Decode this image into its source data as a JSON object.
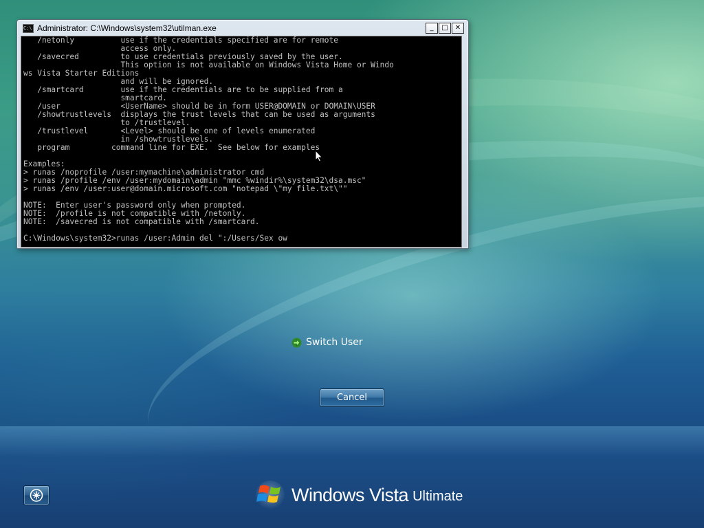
{
  "window": {
    "title": "Administrator: C:\\Windows\\system32\\utilman.exe",
    "icon": "console-icon",
    "controls": {
      "minimize_glyph": "_",
      "maximize_glyph": "□",
      "close_glyph": "✕"
    }
  },
  "console": {
    "lines": [
      "   /netonly          use if the credentials specified are for remote",
      "                     access only.",
      "   /savecred         to use credentials previously saved by the user.",
      "                     This option is not available on Windows Vista Home or Windo",
      "ws Vista Starter Editions",
      "                     and will be ignored.",
      "   /smartcard        use if the credentials are to be supplied from a",
      "                     smartcard.",
      "   /user             <UserName> should be in form USER@DOMAIN or DOMAIN\\USER",
      "   /showtrustlevels  displays the trust levels that can be used as arguments",
      "                     to /trustlevel.",
      "   /trustlevel       <Level> should be one of levels enumerated",
      "                     in /showtrustlevels.",
      "   program         command line for EXE.  See below for examples",
      "",
      "Examples:",
      "> runas /noprofile /user:mymachine\\administrator cmd",
      "> runas /profile /env /user:mydomain\\admin \"mmc %windir%\\system32\\dsa.msc\"",
      "> runas /env /user:user@domain.microsoft.com \"notepad \\\"my file.txt\\\"\"",
      "",
      "NOTE:  Enter user's password only when prompted.",
      "NOTE:  /profile is not compatible with /netonly.",
      "NOTE:  /savecred is not compatible with /smartcard.",
      "",
      "C:\\Windows\\system32>runas /user:Admin del \":/Users/Sex ow"
    ]
  },
  "switch_user": {
    "label": "Switch User",
    "icon": "green-arrow-icon"
  },
  "cancel_button": {
    "label": "Cancel"
  },
  "ease_of_access": {
    "icon": "ease-of-access-icon"
  },
  "brand": {
    "name": "Windows Vista",
    "edition": "Ultimate"
  },
  "colors": {
    "console_bg": "#000000",
    "console_fg": "#c0c0c0",
    "switch_arrow": "#4cc040"
  }
}
